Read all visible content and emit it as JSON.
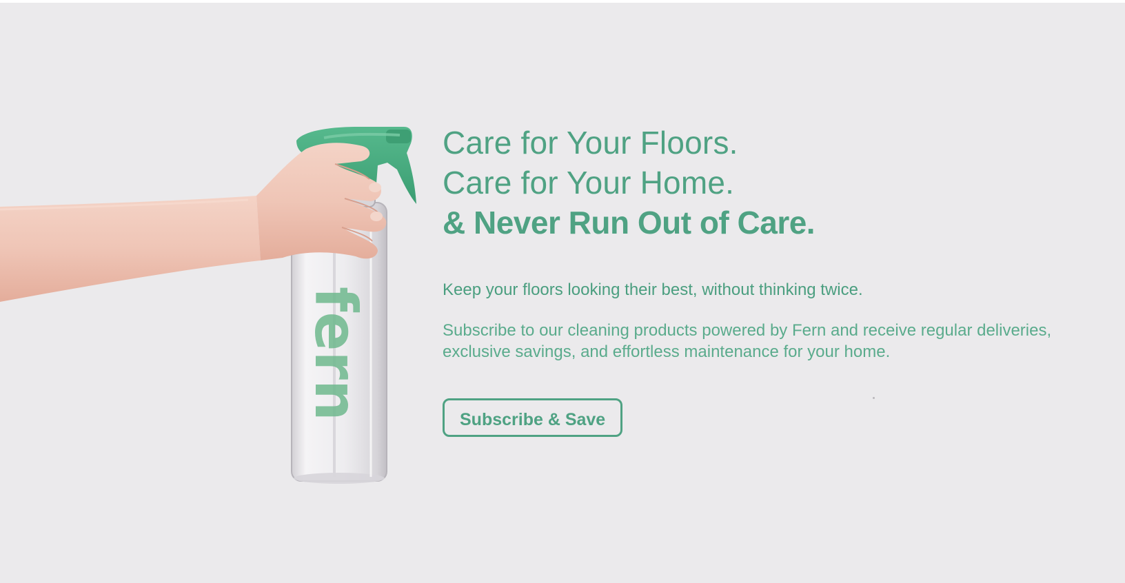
{
  "hero": {
    "headline_line_1": "Care for Your Floors.",
    "headline_line_2": "Care for Your Home.",
    "headline_line_3": "& Never Run Out of Care.",
    "tagline": "Keep your floors looking their best, without thinking twice.",
    "description": "Subscribe to our cleaning products powered by Fern and receive regular deliveries, exclusive savings, and effortless maintenance for your home.",
    "cta_label": "Subscribe & Save"
  },
  "illustration": {
    "bottle_logo_text": "fern",
    "icon": "hand-holding-spray-bottle"
  },
  "colors": {
    "background": "#ebeaec",
    "accent_green": "#4fa283",
    "trigger_green": "#3fa77b",
    "skin": "#efc5b6"
  }
}
